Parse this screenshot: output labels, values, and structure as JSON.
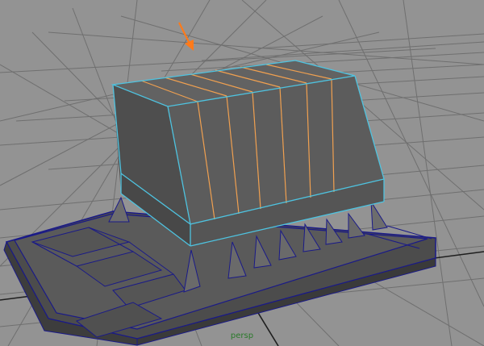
{
  "viewport": {
    "camera_label": "persp",
    "background_color": "#939393",
    "grid_color": "#6e6e6e",
    "grid_axis_color": "#1e1e1e"
  },
  "model": {
    "face_color": "#5c5c5c",
    "face_dark": "#4a4a4a",
    "face_light": "#6a6a6a",
    "selected_edge_color": "#f0a050",
    "border_edge_color": "#4ec3e0",
    "base_outline_color": "#1a1a88"
  },
  "annotation": {
    "arrow_color": "#ff7a1a",
    "icon": "arrow-pointer-icon"
  }
}
